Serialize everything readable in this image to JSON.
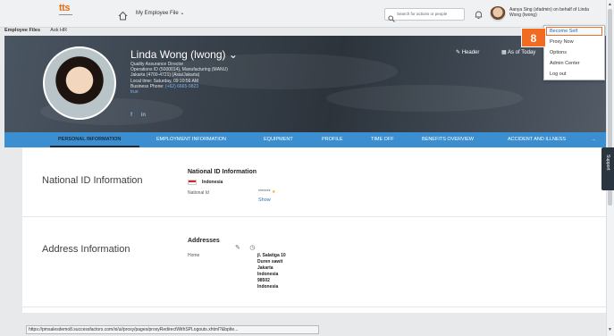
{
  "shell": {
    "logo_text": "tts",
    "module": "My Employee File",
    "search_placeholder": "Search for actions or people",
    "user_context": "Aanya Sing (sfadmin) on behalf of Linda Wong (lwong)"
  },
  "subnav": [
    "Employee Files",
    "Ask HR"
  ],
  "profile": {
    "name": "Linda Wong (lwong)",
    "lines": [
      "Quality Assurance Director",
      "Operations ID (5000014), Manufacturing (MANU)",
      "Jakarta (4700-4721) (Asia/Jakarta)",
      "Local time: Saturday, 09:10:56 AM"
    ],
    "phone_label": "Business Phone:",
    "phone": "(+62) 6665-9823",
    "true_text": "true",
    "social": [
      "f",
      "in"
    ],
    "header_btn": "Header",
    "asof_btn": "As of Today"
  },
  "badge_number": "8",
  "dropdown": [
    "Become Self",
    "Proxy Now",
    "Options",
    "Admin Center",
    "Log out"
  ],
  "tabs": [
    "PERSONAL INFORMATION",
    "EMPLOYMENT INFORMATION",
    "EQUIPMENT",
    "PROFILE",
    "TIME OFF",
    "BENEFITS OVERVIEW",
    "ACCIDENT AND ILLNESS",
    "..."
  ],
  "national_id": {
    "section_title": "National ID Information",
    "heading": "National ID Information",
    "country": "Indonesia",
    "field_label": "National Id",
    "masked": "*******",
    "show": "Show"
  },
  "address": {
    "section_title": "Address Information",
    "heading": "Addresses",
    "type": "Home",
    "lines": [
      "jl. Salatiga 10",
      "Duren sawit",
      "Jakarta",
      "Indonesia",
      "98502",
      "Indonesia"
    ]
  },
  "support": "Support",
  "status_url": "https://pmsalesdemo8.successfactors.com/xi/ui/proxy/pages/proxyRedirectWithSPLogouts.xhtml?&bplte...",
  "colors": {
    "accent": "#f26b22",
    "tab_bar": "#3b8fd0",
    "link": "#2a6fb3"
  }
}
